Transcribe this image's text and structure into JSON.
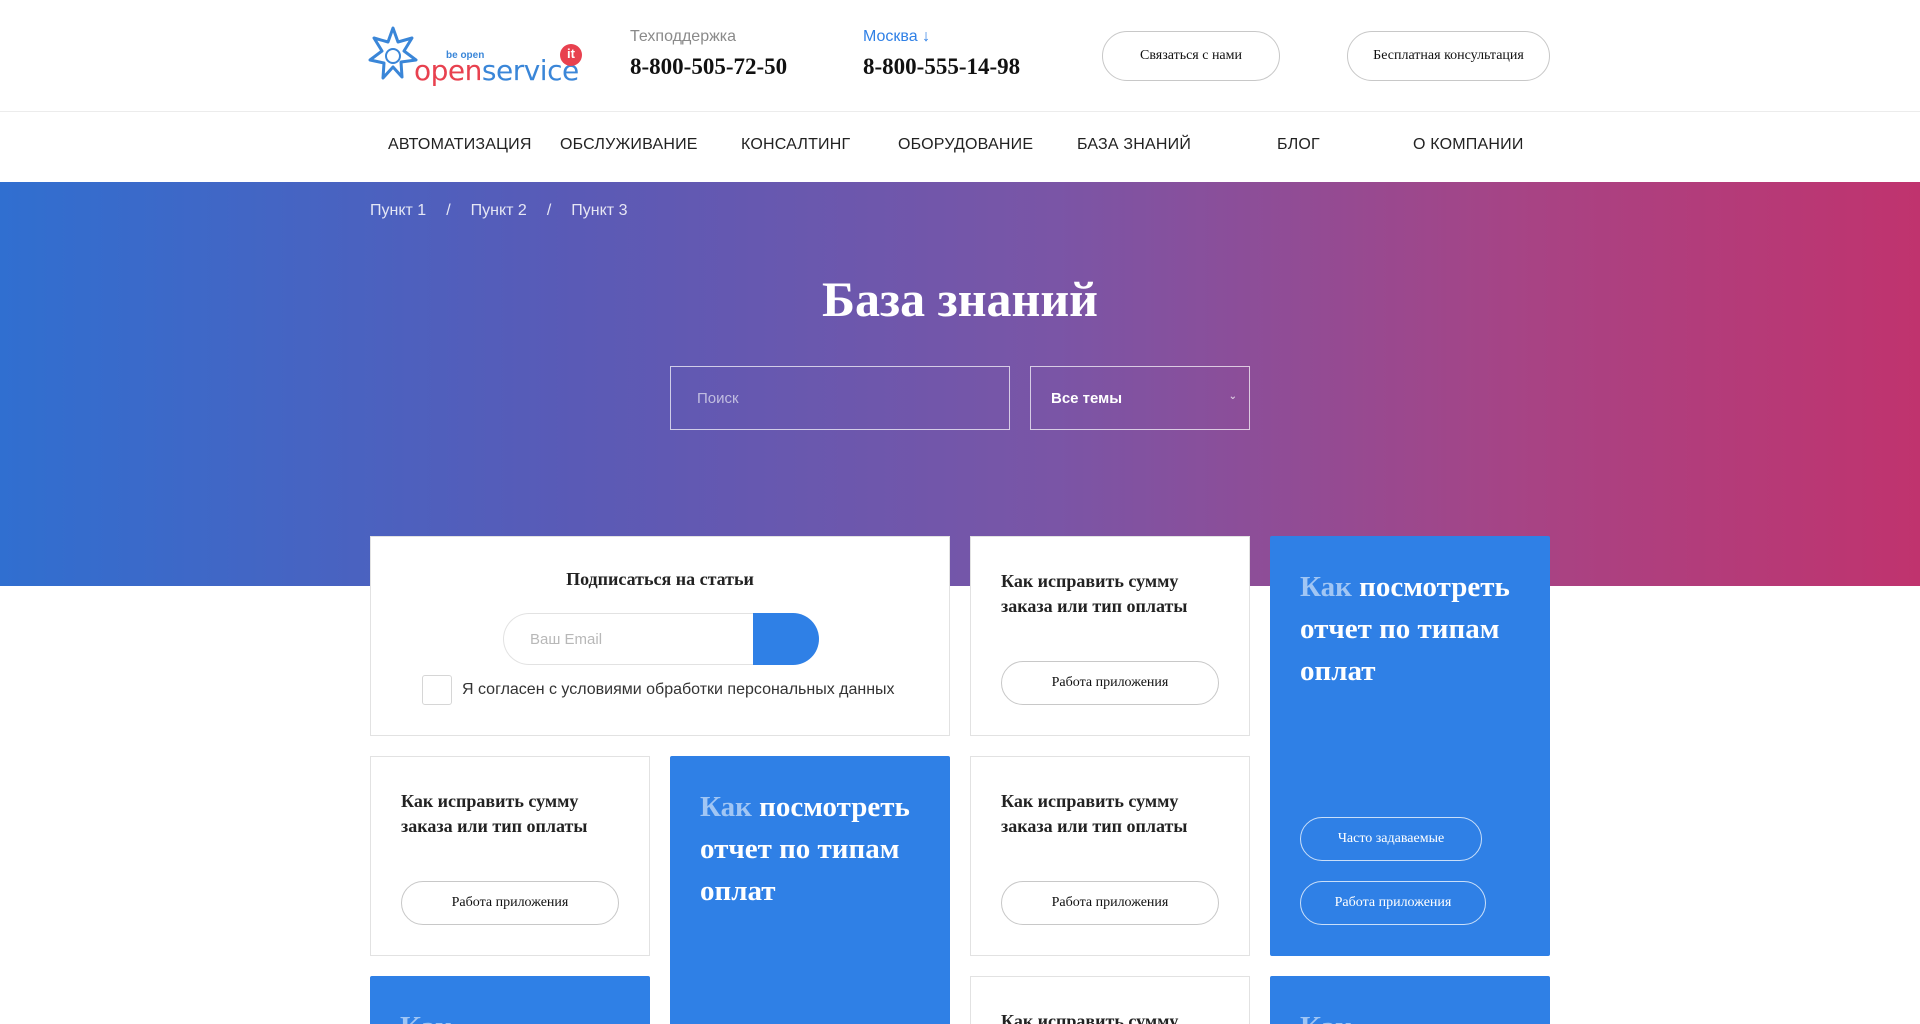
{
  "header": {
    "logo": {
      "be_open": "be open",
      "open": "open",
      "service": "service",
      "it": "it"
    },
    "support": {
      "label": "Техподдержка",
      "phone": "8-800-505-72-50"
    },
    "city": {
      "label": "Москва ↓",
      "phone": "8-800-555-14-98"
    },
    "contact_button": "Связаться с нами",
    "consult_button": "Бесплатная консультация"
  },
  "nav": {
    "items": [
      {
        "label": "АВТОМАТИЗАЦИЯ"
      },
      {
        "label": "ОБСЛУЖИВАНИЕ"
      },
      {
        "label": "КОНСАЛТИНГ"
      },
      {
        "label": "ОБОРУДОВАНИЕ"
      },
      {
        "label": "БАЗА ЗНАНИЙ"
      },
      {
        "label": "БЛОГ"
      },
      {
        "label": "О КОМПАНИИ"
      }
    ]
  },
  "breadcrumb": {
    "items": [
      "Пункт 1",
      "Пункт 2",
      "Пункт 3"
    ],
    "separator": "/"
  },
  "hero": {
    "title": "База знаний",
    "search_placeholder": "Поиск",
    "topic_select": "Все темы"
  },
  "subscribe": {
    "title": "Подписаться на статьи",
    "email_placeholder": "Ваш Email",
    "consent": "Я согласен с условиями обработки персональных данных"
  },
  "white_card": {
    "title": "Как исправить сумму заказа или тип оплаты",
    "tag": "Работа приложения"
  },
  "blue_card": {
    "title_first": "Как",
    "title_rest": "посмотреть отчет по типам оплат",
    "tag_faq": "Часто задаваемые",
    "tag_app": "Работа приложения"
  },
  "colors": {
    "accent": "#2f80e6",
    "logo_red": "#e8414f",
    "gradient_start": "#306fd0",
    "gradient_end": "#c0336e"
  }
}
